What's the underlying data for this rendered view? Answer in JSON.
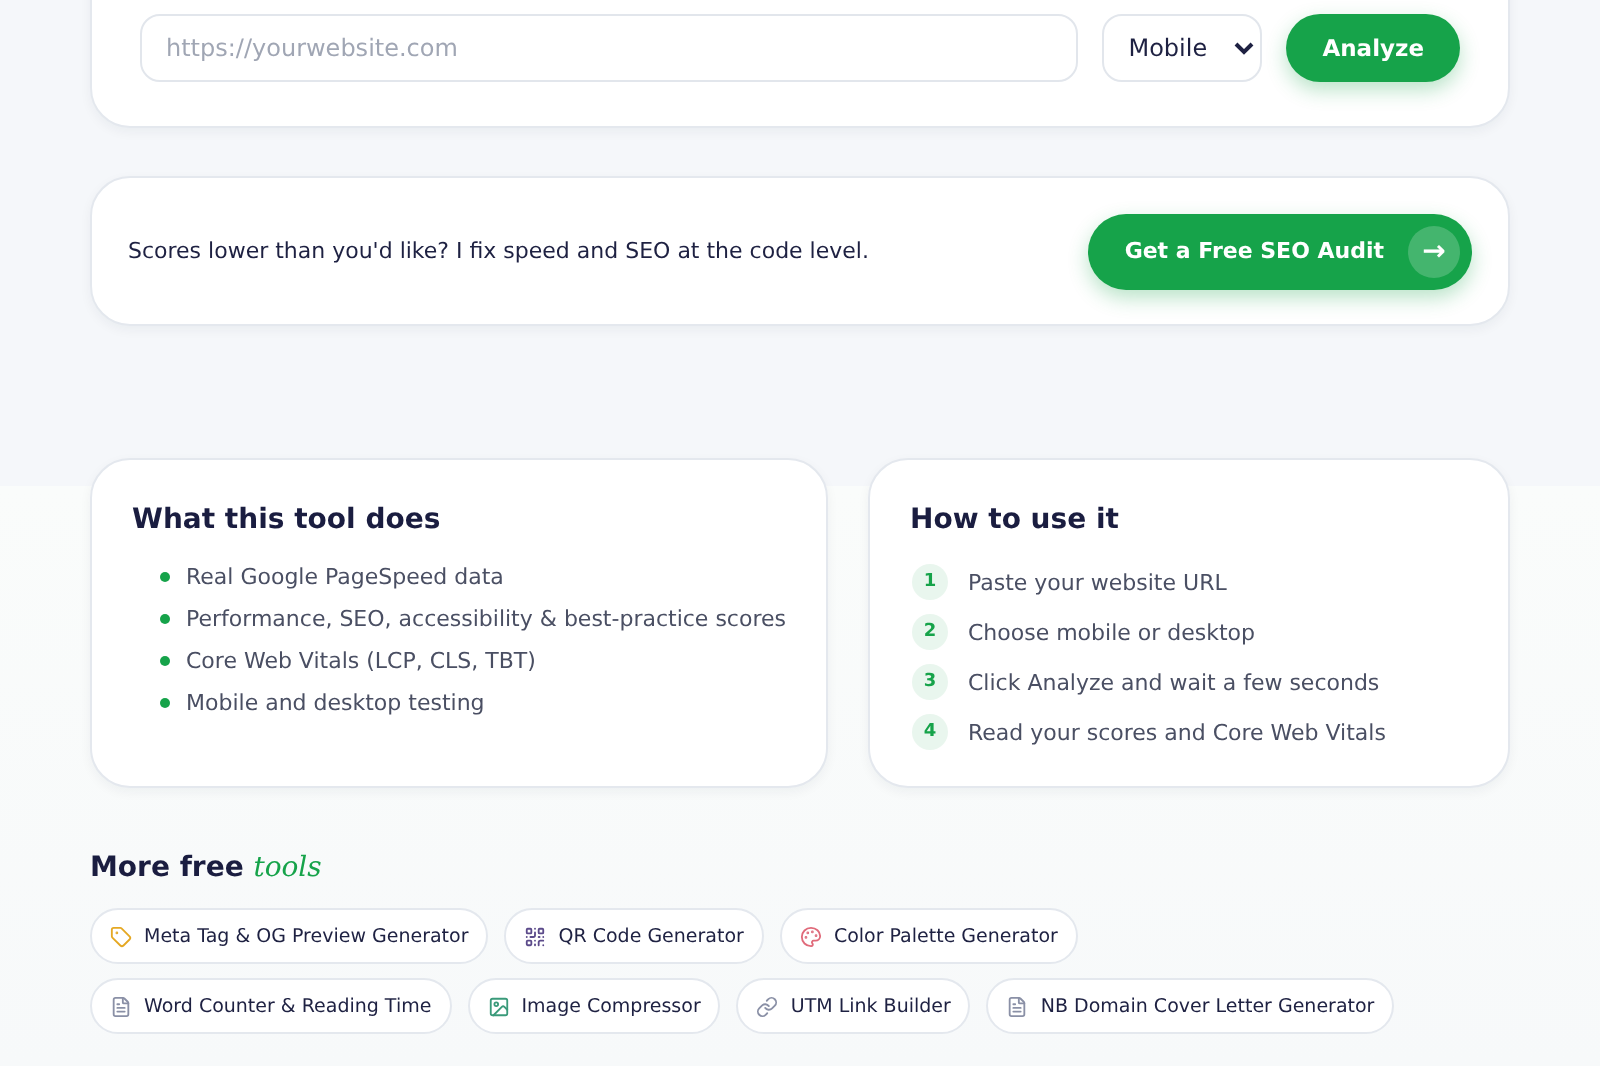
{
  "analyzer": {
    "url_placeholder": "https://yourwebsite.com",
    "device": "Mobile",
    "button": "Analyze"
  },
  "cta": {
    "text": "Scores lower than you'd like? I fix speed and SEO at the code level.",
    "button": "Get a Free SEO Audit",
    "arrow": "→"
  },
  "features": {
    "title": "What this tool does",
    "items": [
      "Real Google PageSpeed data",
      "Performance, SEO, accessibility & best-practice scores",
      "Core Web Vitals (LCP, CLS, TBT)",
      "Mobile and desktop testing"
    ]
  },
  "how_to": {
    "title": "How to use it",
    "steps": [
      {
        "number": "1",
        "text": "Paste your website URL"
      },
      {
        "number": "2",
        "text": "Choose mobile or desktop"
      },
      {
        "number": "3",
        "text": "Click Analyze and wait a few seconds"
      },
      {
        "number": "4",
        "text": "Read your scores and Core Web Vitals"
      }
    ]
  },
  "more_tools": {
    "title": "More free",
    "title_accent": "tools",
    "rows": [
      [
        {
          "label": "Meta Tag & OG Preview Generator",
          "kind": "tag"
        },
        {
          "label": "QR Code Generator",
          "kind": "qr"
        },
        {
          "label": "Color Palette Generator",
          "kind": "palette"
        }
      ],
      [
        {
          "label": "Word Counter & Reading Time",
          "kind": "document"
        },
        {
          "label": "Image Compressor",
          "kind": "image"
        },
        {
          "label": "UTM Link Builder",
          "kind": "link"
        },
        {
          "label": "NB Domain Cover Letter Generator",
          "kind": "document"
        }
      ]
    ]
  }
}
